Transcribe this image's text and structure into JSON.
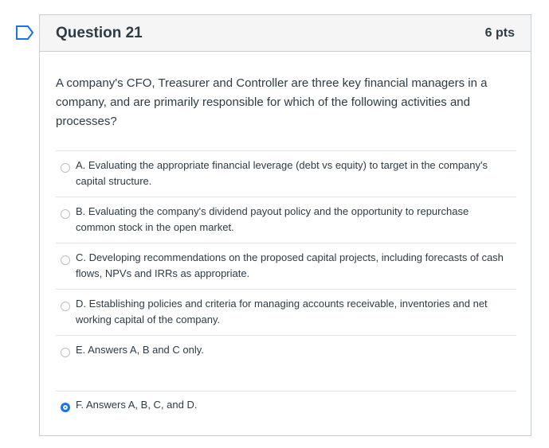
{
  "question": {
    "flag_icon": "bookmark-flag-icon",
    "title": "Question 21",
    "points": "6 pts",
    "text": "A company's CFO, Treasurer and Controller are three key financial managers in a company, and are primarily responsible for which of the following activities and processes?"
  },
  "answers": [
    {
      "label": "A. Evaluating the appropriate financial leverage (debt vs equity) to target in the company's capital structure.",
      "selected": false
    },
    {
      "label": "B. Evaluating the company's dividend payout policy and the opportunity to repurchase common stock in the open market.",
      "selected": false
    },
    {
      "label": "C. Developing recommendations on the proposed capital projects, including forecasts of cash flows, NPVs and IRRs as appropriate.",
      "selected": false
    },
    {
      "label": "D.  Establishing policies and criteria for managing accounts receivable, inventories and net working capital of the company.",
      "selected": false
    },
    {
      "label": "E. Answers A, B and C only.",
      "selected": false
    },
    {
      "label": "F.  Answers A, B, C, and D.",
      "selected": true
    }
  ],
  "colors": {
    "accent": "#1a73e8",
    "border": "#c7cdd1",
    "header_bg": "#f5f5f5",
    "text": "#2d3b45"
  }
}
